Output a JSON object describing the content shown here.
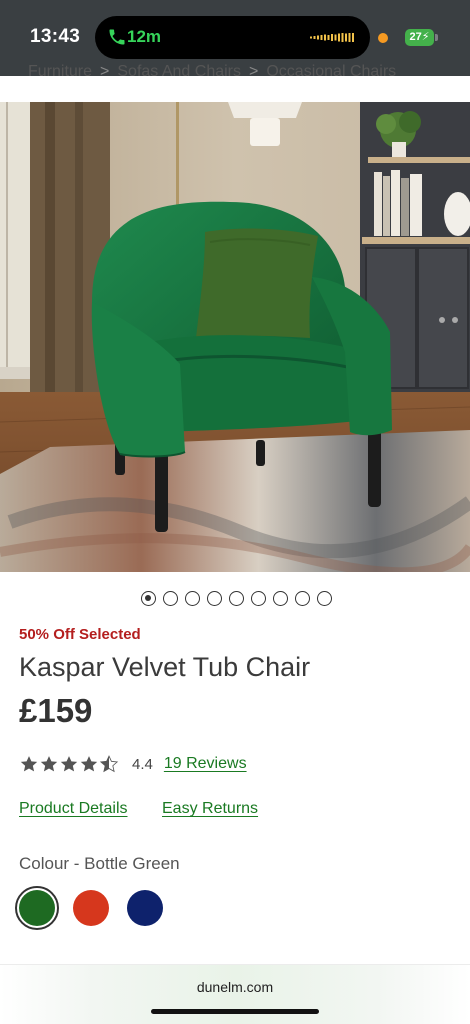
{
  "status_bar": {
    "time": "13:43",
    "call_duration": "12m",
    "battery_level": "27",
    "battery_charging": true
  },
  "breadcrumb": {
    "items": [
      "Furniture",
      "Sofas And Chairs",
      "Occasional Chairs"
    ],
    "separator": ">"
  },
  "product_image": {
    "icon": "armchair-photo",
    "carousel": {
      "total": 9,
      "active_index": 0
    }
  },
  "product": {
    "promo": "50% Off Selected",
    "title": "Kaspar Velvet Tub Chair",
    "price": "£159",
    "rating": 4.4,
    "rating_text": "4.4",
    "reviews_label": "19 Reviews"
  },
  "links": {
    "details": "Product Details",
    "returns": "Easy Returns"
  },
  "colour": {
    "label": "Colour - Bottle Green",
    "swatches": [
      {
        "name": "Bottle Green",
        "hex": "#1e6a22",
        "selected": true
      },
      {
        "name": "Red",
        "hex": "#d6371d",
        "selected": false
      },
      {
        "name": "Navy",
        "hex": "#0e226c",
        "selected": false
      }
    ]
  },
  "browser": {
    "url": "dunelm.com"
  },
  "colors": {
    "accent_link": "#1a7a22",
    "promo_red": "#b41e1e"
  }
}
